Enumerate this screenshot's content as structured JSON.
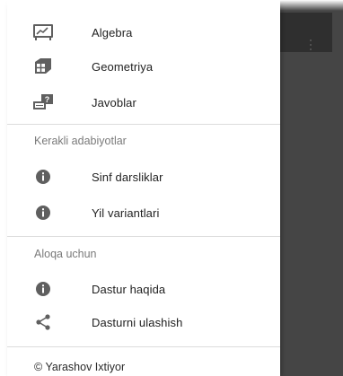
{
  "menu": {
    "items": [
      {
        "label": "Algebra",
        "icon": "chart-board-icon"
      },
      {
        "label": "Geometriya",
        "icon": "cube-icon"
      },
      {
        "label": "Javoblar",
        "icon": "question-board-icon"
      }
    ]
  },
  "sections": [
    {
      "title": "Kerakli adabiyotlar",
      "items": [
        {
          "label": "Sinf darsliklar",
          "icon": "info-icon"
        },
        {
          "label": "Yil variantlari",
          "icon": "info-icon"
        }
      ]
    },
    {
      "title": "Aloqa uchun",
      "items": [
        {
          "label": "Dastur haqida",
          "icon": "info-icon"
        },
        {
          "label": "Dasturni ulashish",
          "icon": "share-icon"
        }
      ]
    }
  ],
  "footer": {
    "text": "© Yarashov Ixtiyor"
  },
  "colors": {
    "drawer_bg": "#ffffff",
    "icon": "#5f5f5f",
    "backdrop": "#454545",
    "divider": "#dcdcdc"
  }
}
